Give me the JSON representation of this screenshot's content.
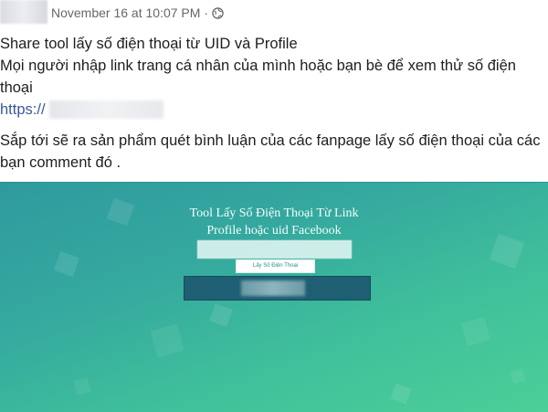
{
  "post": {
    "timestamp": "November 16 at 10:07 PM",
    "separator": "·",
    "privacy_icon": "globe-icon",
    "line1": "Share tool lấy số điện thoại từ UID và Profile",
    "line2": "Mọi người nhập link trang cá nhân của mình hoặc bạn bè để xem thử số điện thoại",
    "link_prefix": "https://",
    "line3": "Sắp tới sẽ ra sản phẩm quét bình luận của các fanpage lấy số điện thoại của các bạn comment đó ."
  },
  "tool_screenshot": {
    "title_line1": "Tool Lấy Số Điện Thoại Từ Link",
    "title_line2": "Profile hoặc uid Facebook",
    "button_label": "Lấy Số Điện Thoại",
    "colors": {
      "gradient_start": "#2f9a9e",
      "gradient_end": "#4ccf98",
      "result_bar": "#1f5f73"
    }
  }
}
